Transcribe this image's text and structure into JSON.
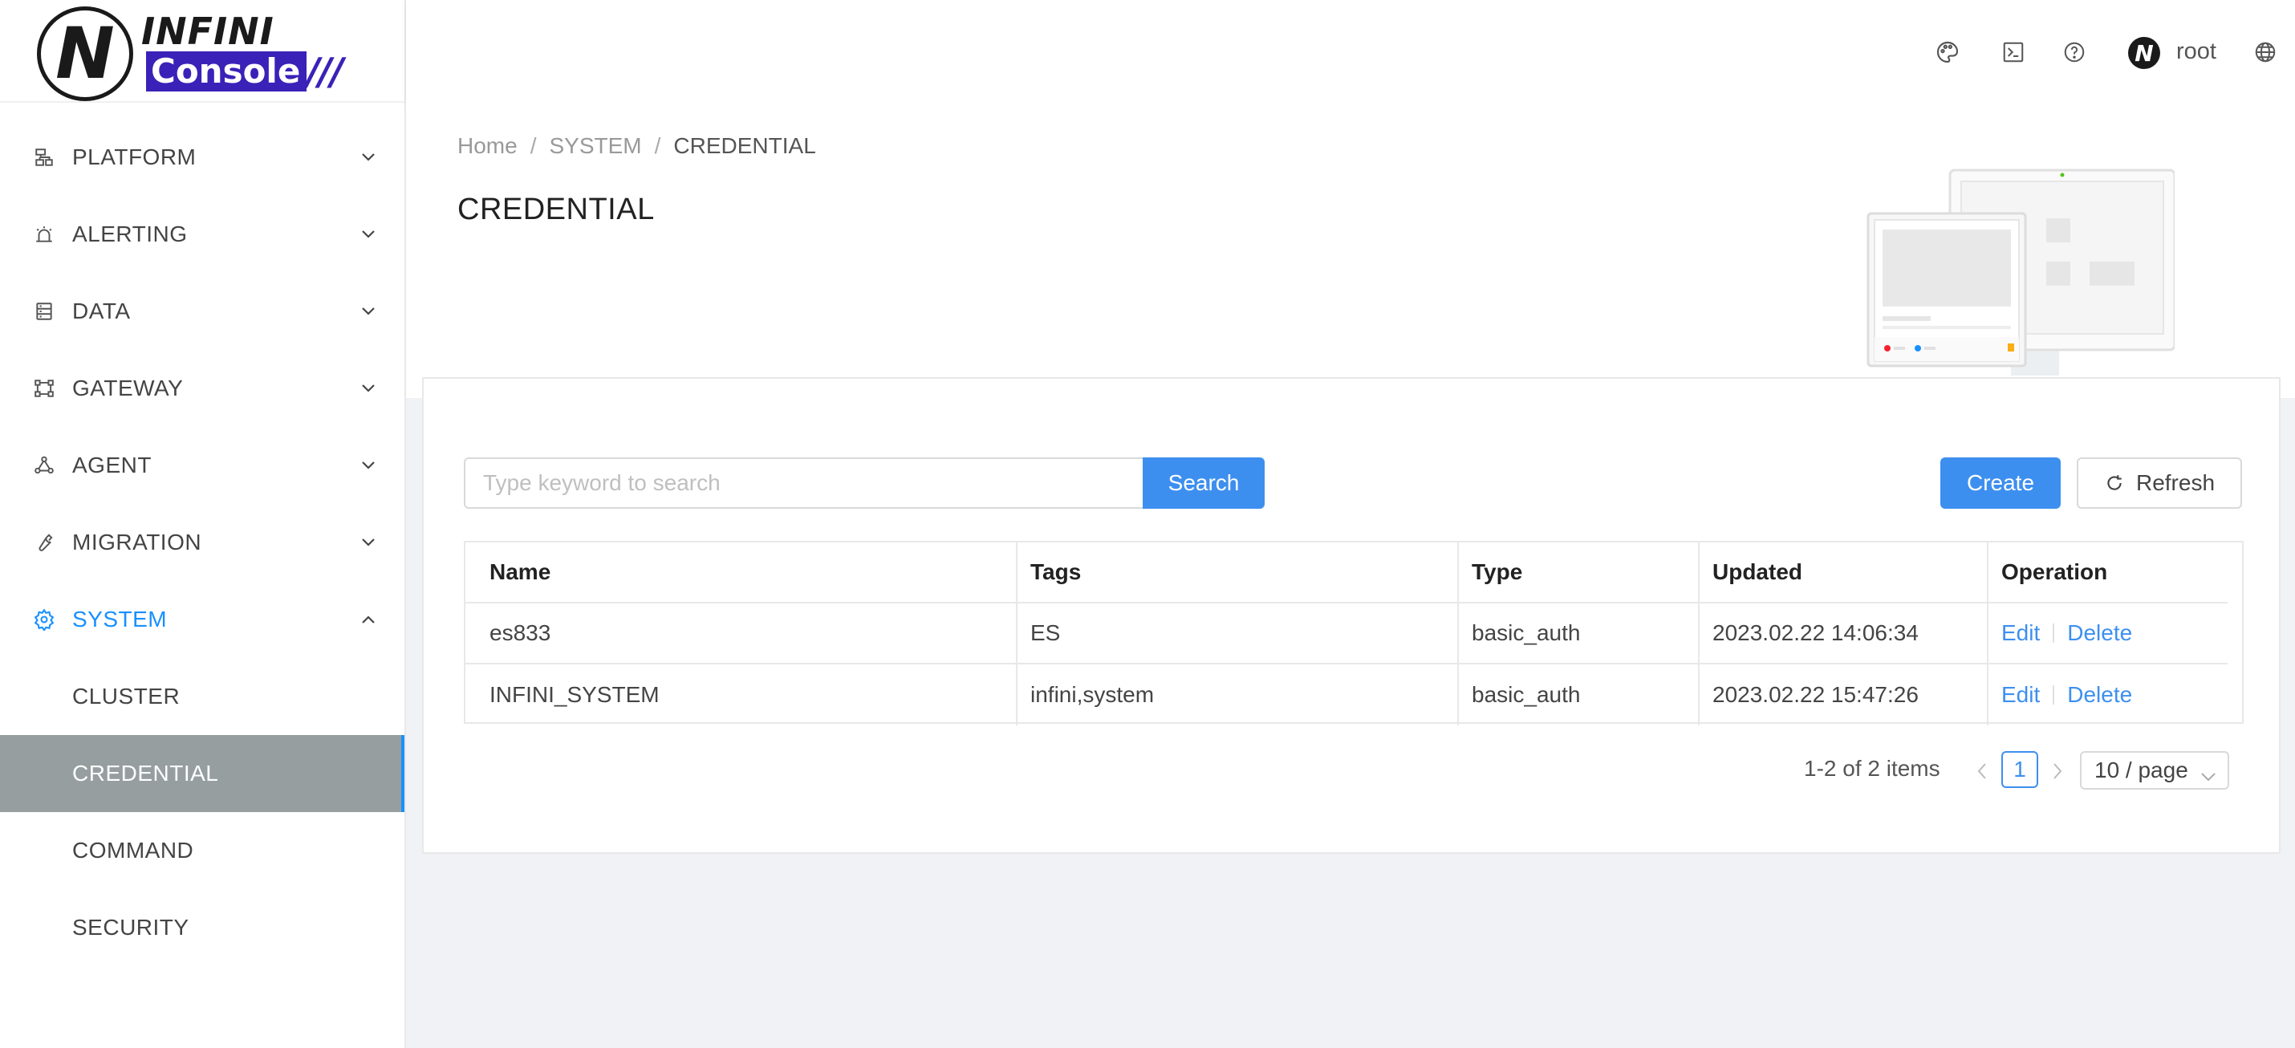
{
  "brand": {
    "mark": "N",
    "top_text": "INFINI",
    "bottom_text": "Console",
    "slashes": "///"
  },
  "sidebar": {
    "items": [
      {
        "label": "PLATFORM",
        "icon": "sitemap-icon"
      },
      {
        "label": "ALERTING",
        "icon": "alarm-icon"
      },
      {
        "label": "DATA",
        "icon": "database-icon"
      },
      {
        "label": "GATEWAY",
        "icon": "gateway-icon"
      },
      {
        "label": "AGENT",
        "icon": "agent-icon"
      },
      {
        "label": "MIGRATION",
        "icon": "wrench-icon"
      },
      {
        "label": "SYSTEM",
        "icon": "gear-icon"
      }
    ],
    "system_children": [
      {
        "label": "CLUSTER"
      },
      {
        "label": "CREDENTIAL"
      },
      {
        "label": "COMMAND"
      },
      {
        "label": "SECURITY"
      }
    ]
  },
  "header": {
    "user_initial": "N",
    "user_name": "root",
    "icons": [
      "palette-icon",
      "terminal-icon",
      "help-icon",
      "globe-icon"
    ]
  },
  "breadcrumb": {
    "home": "Home",
    "section": "SYSTEM",
    "current": "CREDENTIAL"
  },
  "page": {
    "title": "CREDENTIAL"
  },
  "toolbar": {
    "search_placeholder": "Type keyword to search",
    "search_label": "Search",
    "create_label": "Create",
    "refresh_label": "Refresh"
  },
  "table": {
    "columns": [
      "Name",
      "Tags",
      "Type",
      "Updated",
      "Operation"
    ],
    "rows": [
      {
        "name": "es833",
        "tags": "ES",
        "type": "basic_auth",
        "updated": "2023.02.22 14:06:34",
        "edit": "Edit",
        "delete": "Delete"
      },
      {
        "name": "INFINI_SYSTEM",
        "tags": "infini,system",
        "type": "basic_auth",
        "updated": "2023.02.22 15:47:26",
        "edit": "Edit",
        "delete": "Delete"
      }
    ]
  },
  "pagination": {
    "total_text": "1-2 of 2 items",
    "current_page": "1",
    "page_size": "10 / page"
  },
  "colors": {
    "accent": "#1890ff",
    "primary_button": "#3d8fef",
    "selected_bg": "#969e9f",
    "brand_purple": "#3a22b8"
  }
}
